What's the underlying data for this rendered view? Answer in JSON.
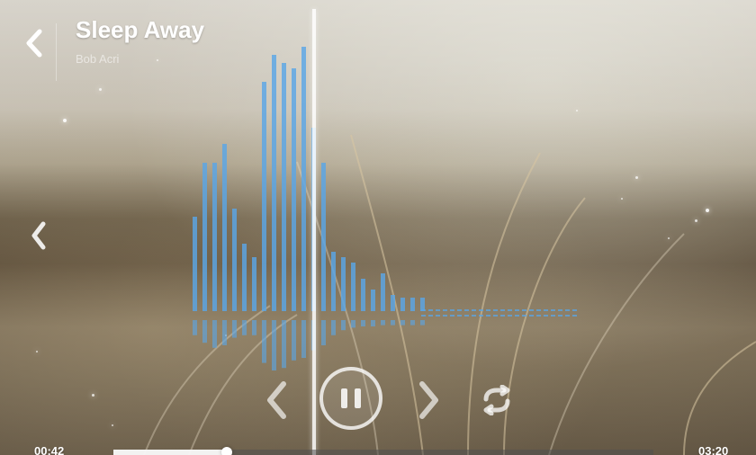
{
  "now_playing": {
    "title": "Sleep Away",
    "artist": "Bob Acri"
  },
  "playback": {
    "elapsed": "00:42",
    "total": "03:20",
    "progress_fraction": 0.21,
    "state": "playing"
  },
  "icons": {
    "back": "chevron-left-icon",
    "side_prev": "chevron-left-icon",
    "prev": "chevron-left-icon",
    "next": "chevron-right-icon",
    "pause": "pause-icon",
    "repeat": "repeat-icon"
  },
  "visualizer": {
    "bar_levels_up": [
      0.35,
      0.55,
      0.55,
      0.62,
      0.38,
      0.25,
      0.2,
      0.85,
      0.95,
      0.92,
      0.9,
      0.98,
      0.68,
      0.55,
      0.22,
      0.2,
      0.18,
      0.12,
      0.08,
      0.14,
      0.06,
      0.05,
      0.05,
      0.05
    ],
    "bar_levels_down": [
      0.12,
      0.18,
      0.22,
      0.2,
      0.14,
      0.12,
      0.12,
      0.34,
      0.4,
      0.38,
      0.32,
      0.3,
      0.24,
      0.2,
      0.12,
      0.08,
      0.06,
      0.05,
      0.05,
      0.04,
      0.04,
      0.04,
      0.04,
      0.04
    ],
    "color": "#5aa6e6"
  }
}
